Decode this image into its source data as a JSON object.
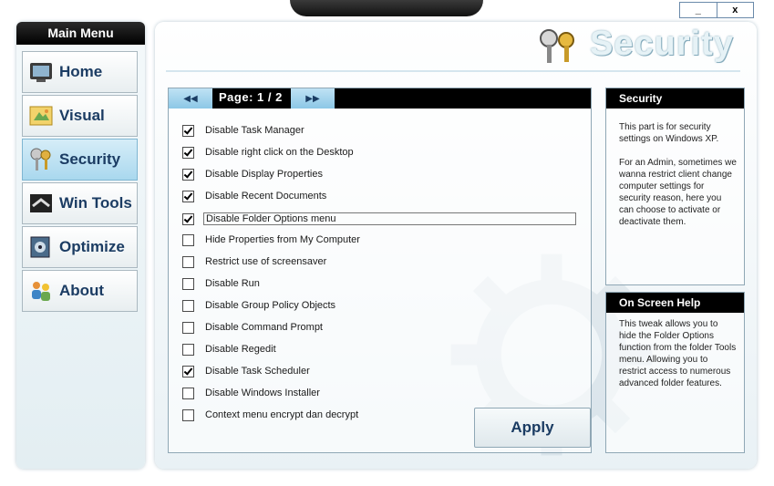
{
  "window": {
    "minimize_label": "_",
    "close_label": "x"
  },
  "sidebar": {
    "title": "Main Menu",
    "items": [
      {
        "label": "Home",
        "icon": "home-icon",
        "active": false
      },
      {
        "label": "Visual",
        "icon": "visual-icon",
        "active": false
      },
      {
        "label": "Security",
        "icon": "security-icon",
        "active": true
      },
      {
        "label": "Win Tools",
        "icon": "wintools-icon",
        "active": false
      },
      {
        "label": "Optimize",
        "icon": "optimize-icon",
        "active": false
      },
      {
        "label": "About",
        "icon": "about-icon",
        "active": false
      }
    ]
  },
  "header": {
    "title": "Security"
  },
  "pager": {
    "label": "Page:  1 / 2",
    "prev_icon": "rewind-icon",
    "next_icon": "fast-forward-icon"
  },
  "options": [
    {
      "label": "Disable Task Manager",
      "checked": true
    },
    {
      "label": "Disable right click on the Desktop",
      "checked": true
    },
    {
      "label": "Disable Display Properties",
      "checked": true
    },
    {
      "label": "Disable Recent Documents",
      "checked": true
    },
    {
      "label": "Disable Folder Options menu",
      "checked": true
    },
    {
      "label": "Hide Properties from My Computer",
      "checked": false
    },
    {
      "label": "Restrict use of screensaver",
      "checked": false
    },
    {
      "label": "Disable Run",
      "checked": false
    },
    {
      "label": "Disable Group Policy Objects",
      "checked": false
    },
    {
      "label": "Disable Command Prompt",
      "checked": false
    },
    {
      "label": "Disable Regedit",
      "checked": false
    },
    {
      "label": "Disable Task Scheduler",
      "checked": true
    },
    {
      "label": "Disable Windows Installer",
      "checked": false
    },
    {
      "label": "Context menu encrypt dan decrypt",
      "checked": false
    }
  ],
  "apply_label": "Apply",
  "info": {
    "title": "Security",
    "para1": "This part is for security settings on Windows XP.",
    "para2": "For an Admin, sometimes we wanna restrict client change computer settings for security reason, here you can choose to activate or deactivate them."
  },
  "help": {
    "title": "On Screen Help",
    "text": "This tweak allows you to hide the Folder Options function from the folder Tools menu. Allowing you to restrict access to numerous advanced folder features."
  },
  "colors": {
    "accent": "#1b3c63",
    "active": "#a9d8ee",
    "header_bg": "#000000"
  }
}
